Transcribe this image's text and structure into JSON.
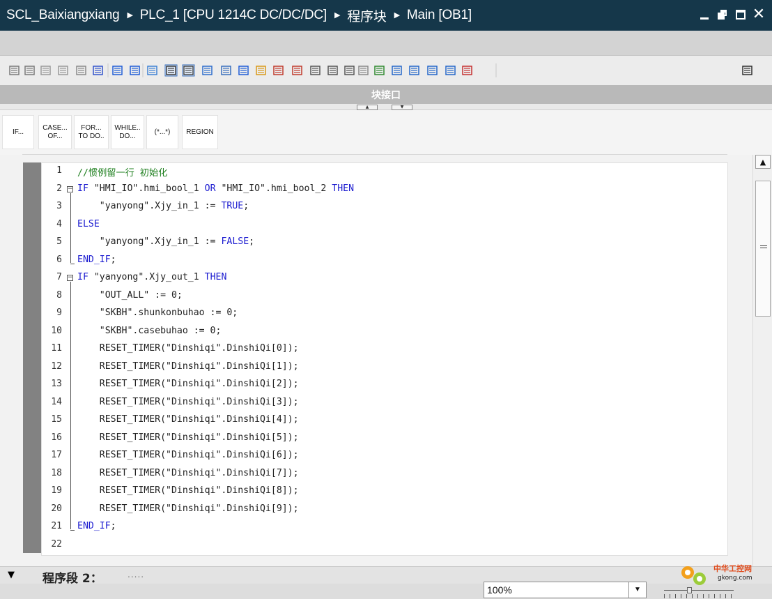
{
  "titlebar": {
    "crumbs": [
      "SCL_Baixiangxiang",
      "PLC_1 [CPU 1214C DC/DC/DC]",
      "程序块",
      "Main [OB1]"
    ],
    "separator": "▶",
    "colors": {
      "background": "#15374a",
      "text": "#ffffff"
    }
  },
  "interface_bar": {
    "title": "块接口"
  },
  "snippets": [
    {
      "line1": "IF...",
      "line2": ""
    },
    {
      "line1": "CASE...",
      "line2": "OF..."
    },
    {
      "line1": "FOR...",
      "line2": "TO DO.."
    },
    {
      "line1": "WHILE..",
      "line2": "DO..."
    },
    {
      "line1": "(*...*)",
      "line2": ""
    },
    {
      "line1": "REGION",
      "line2": ""
    }
  ],
  "toolbar_icons": [
    "insert-network-icon",
    "delete-network-icon",
    "insert-row-icon",
    "delete-row-icon",
    "monitor-icon",
    "absolute-relative-icon",
    "expand-networks-icon",
    "collapse-networks-icon",
    "comment-icon",
    "network-comments-icon",
    "show-favorites-icon",
    "call-structure-icon",
    "watch-list-icon",
    "list-icon",
    "favorites-icon",
    "breakpoint-set-icon",
    "breakpoint-clear-icon",
    "step-over-icon",
    "step-into-icon",
    "step-out-icon",
    "go-to-icon",
    "indent-icon",
    "outdent-icon",
    "auto-format-icon",
    "comment-line-icon",
    "uncomment-line-icon",
    "more-icon",
    "block-properties-icon"
  ],
  "code": {
    "lines": [
      {
        "n": "1",
        "parts": [
          {
            "t": "//惯例留一行 初始化",
            "c": "cm"
          }
        ]
      },
      {
        "n": "2",
        "fold": "⊟",
        "parts": [
          {
            "t": "IF",
            "c": "kw"
          },
          {
            "t": " \"HMI_IO\".hmi_bool_1 ",
            "c": "str"
          },
          {
            "t": "OR",
            "c": "kw"
          },
          {
            "t": " \"HMI_IO\".hmi_bool_2 ",
            "c": "str"
          },
          {
            "t": "THEN",
            "c": "kw"
          }
        ]
      },
      {
        "n": "3",
        "parts": [
          {
            "t": "    \"yanyong\".Xjy_in_1 := ",
            "c": "str"
          },
          {
            "t": "TRUE",
            "c": "kw"
          },
          {
            "t": ";",
            "c": "str"
          }
        ]
      },
      {
        "n": "4",
        "parts": [
          {
            "t": "ELSE",
            "c": "kw"
          }
        ]
      },
      {
        "n": "5",
        "parts": [
          {
            "t": "    \"yanyong\".Xjy_in_1 := ",
            "c": "str"
          },
          {
            "t": "FALSE",
            "c": "kw"
          },
          {
            "t": ";",
            "c": "str"
          }
        ]
      },
      {
        "n": "6",
        "parts": [
          {
            "t": "END_IF",
            "c": "kw"
          },
          {
            "t": ";",
            "c": "str"
          }
        ]
      },
      {
        "n": "7",
        "fold": "⊟",
        "parts": [
          {
            "t": "IF",
            "c": "kw"
          },
          {
            "t": " \"yanyong\".Xjy_out_1 ",
            "c": "str"
          },
          {
            "t": "THEN",
            "c": "kw"
          }
        ]
      },
      {
        "n": "8",
        "parts": [
          {
            "t": "    \"OUT_ALL\" := 0;",
            "c": "str"
          }
        ]
      },
      {
        "n": "9",
        "parts": [
          {
            "t": "    \"SKBH\".shunkonbuhao := 0;",
            "c": "str"
          }
        ]
      },
      {
        "n": "10",
        "parts": [
          {
            "t": "    \"SKBH\".casebuhao := 0;",
            "c": "str"
          }
        ]
      },
      {
        "n": "11",
        "parts": [
          {
            "t": "    RESET_TIMER(\"Dinshiqi\".DinshiQi[0]);",
            "c": "str"
          }
        ]
      },
      {
        "n": "12",
        "parts": [
          {
            "t": "    RESET_TIMER(\"Dinshiqi\".DinshiQi[1]);",
            "c": "str"
          }
        ]
      },
      {
        "n": "13",
        "parts": [
          {
            "t": "    RESET_TIMER(\"Dinshiqi\".DinshiQi[2]);",
            "c": "str"
          }
        ]
      },
      {
        "n": "14",
        "parts": [
          {
            "t": "    RESET_TIMER(\"Dinshiqi\".DinshiQi[3]);",
            "c": "str"
          }
        ]
      },
      {
        "n": "15",
        "parts": [
          {
            "t": "    RESET_TIMER(\"Dinshiqi\".DinshiQi[4]);",
            "c": "str"
          }
        ]
      },
      {
        "n": "16",
        "parts": [
          {
            "t": "    RESET_TIMER(\"Dinshiqi\".DinshiQi[5]);",
            "c": "str"
          }
        ]
      },
      {
        "n": "17",
        "parts": [
          {
            "t": "    RESET_TIMER(\"Dinshiqi\".DinshiQi[6]);",
            "c": "str"
          }
        ]
      },
      {
        "n": "18",
        "parts": [
          {
            "t": "    RESET_TIMER(\"Dinshiqi\".DinshiQi[7]);",
            "c": "str"
          }
        ]
      },
      {
        "n": "19",
        "parts": [
          {
            "t": "    RESET_TIMER(\"Dinshiqi\".DinshiQi[8]);",
            "c": "str"
          }
        ]
      },
      {
        "n": "20",
        "parts": [
          {
            "t": "    RESET_TIMER(\"Dinshiqi\".DinshiQi[9]);",
            "c": "str"
          }
        ]
      },
      {
        "n": "21",
        "parts": [
          {
            "t": "END_IF",
            "c": "kw"
          },
          {
            "t": ";",
            "c": "str"
          }
        ]
      },
      {
        "n": "22",
        "parts": []
      }
    ],
    "colors": {
      "keyword": "#1b1bd0",
      "comment": "#208020",
      "text": "#222222"
    }
  },
  "network": {
    "arrow": "▼",
    "title": "程序段 2：",
    "comment_placeholder": "....."
  },
  "status": {
    "zoom": "100%"
  },
  "watermark": {
    "text": "中华工控网",
    "sub": "gkong.com"
  }
}
